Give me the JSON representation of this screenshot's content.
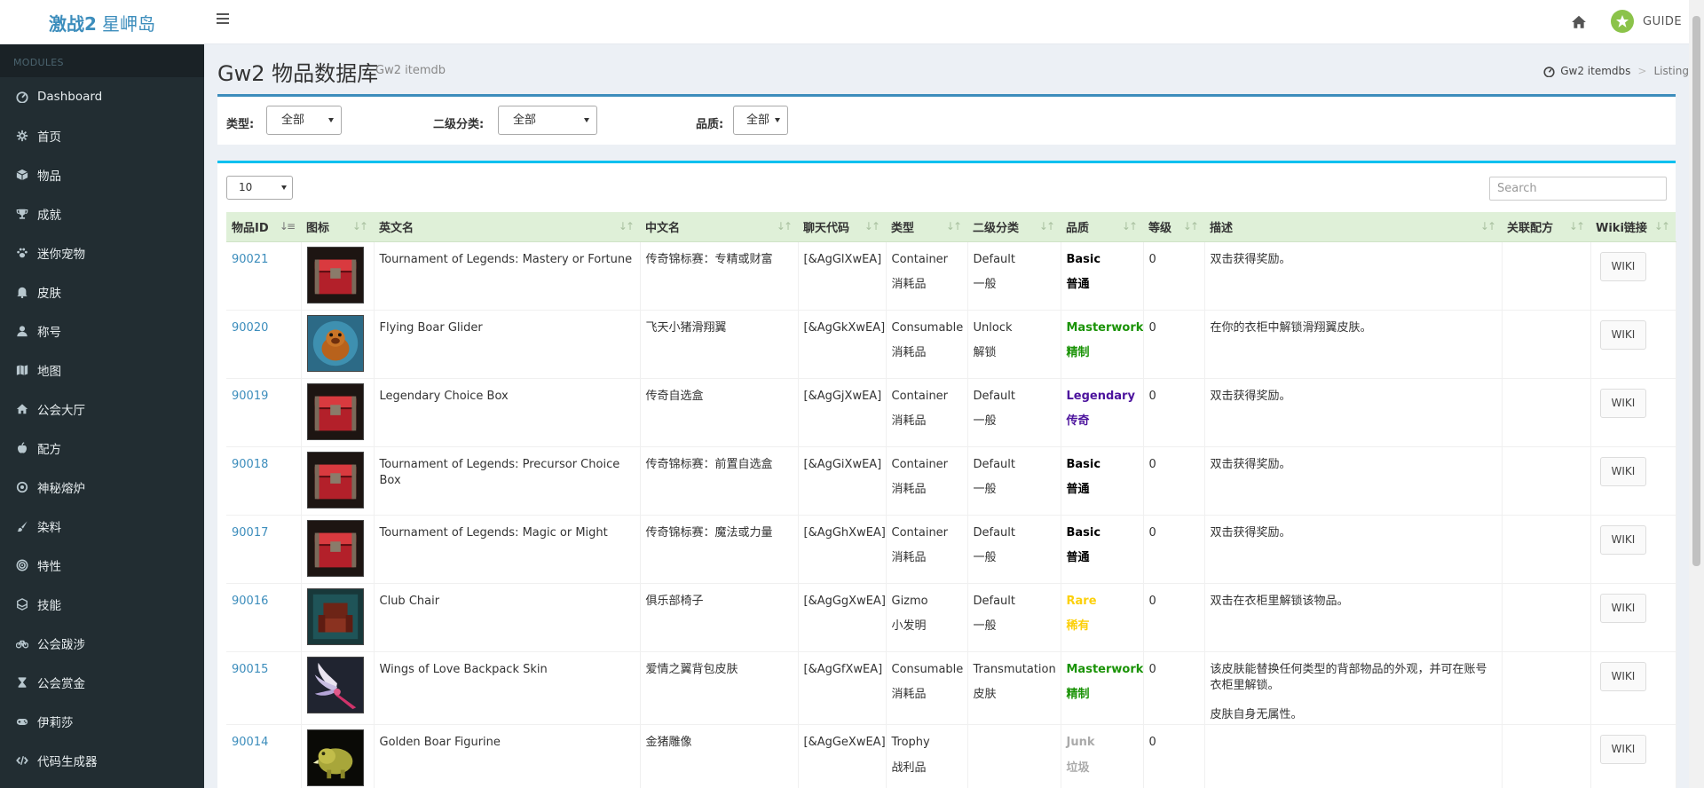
{
  "header": {
    "logo_bold": "激战2",
    "logo_text": "星岬岛",
    "guide": "GUIDE"
  },
  "sidebar": {
    "heading": "MODULES",
    "items": [
      {
        "label": "Dashboard",
        "icon": "tachometer-icon"
      },
      {
        "label": "首页",
        "icon": "cog-icon"
      },
      {
        "label": "物品",
        "icon": "cube-icon"
      },
      {
        "label": "成就",
        "icon": "trophy-icon"
      },
      {
        "label": "迷你宠物",
        "icon": "paw-icon"
      },
      {
        "label": "皮肤",
        "icon": "bell-icon"
      },
      {
        "label": "称号",
        "icon": "user-icon"
      },
      {
        "label": "地图",
        "icon": "map-icon"
      },
      {
        "label": "公会大厅",
        "icon": "home-icon"
      },
      {
        "label": "配方",
        "icon": "apple-icon"
      },
      {
        "label": "神秘熔炉",
        "icon": "dot-circle-icon"
      },
      {
        "label": "染料",
        "icon": "paint-brush-icon"
      },
      {
        "label": "特性",
        "icon": "bullseye-icon"
      },
      {
        "label": "技能",
        "icon": "cubes-icon"
      },
      {
        "label": "公会跋涉",
        "icon": "bicycle-icon"
      },
      {
        "label": "公会赏金",
        "icon": "hourglass-icon"
      },
      {
        "label": "伊莉莎",
        "icon": "gamepad-icon"
      },
      {
        "label": "代码生成器",
        "icon": "code-icon"
      }
    ]
  },
  "page": {
    "title": "Gw2 物品数据库",
    "subtitle": "Gw2 itemdb",
    "breadcrumb": [
      "Gw2 itemdbs",
      "Listing"
    ]
  },
  "filters": {
    "type_label": "类型:",
    "type_value": "全部",
    "subtype_label": "二级分类:",
    "subtype_value": "全部",
    "rarity_label": "品质:",
    "rarity_value": "全部"
  },
  "table": {
    "page_length": "10",
    "search_placeholder": "Search",
    "columns": [
      "物品ID",
      "图标",
      "英文名",
      "中文名",
      "聊天代码",
      "类型",
      "二级分类",
      "品质",
      "等级",
      "描述",
      "关联配方",
      "Wiki链接"
    ],
    "wiki_label": "WIKI",
    "rows": [
      {
        "id": "90021",
        "icon": "chest-icon",
        "en": "Tournament of Legends: Mastery or Fortune",
        "zh": "传奇锦标赛：专精或财富",
        "chat": "[&AgGlXwEA]",
        "type_en": "Container",
        "type_zh": "消耗品",
        "sub_en": "Default",
        "sub_zh": "一般",
        "q_en": "Basic",
        "q_zh": "普通",
        "q_color": "#000000",
        "level": "0",
        "desc": [
          "双击获得奖励。"
        ]
      },
      {
        "id": "90020",
        "icon": "boar-glider-icon",
        "en": "Flying Boar Glider",
        "zh": "飞天小猪滑翔翼",
        "chat": "[&AgGkXwEA]",
        "type_en": "Consumable",
        "type_zh": "消耗品",
        "sub_en": "Unlock",
        "sub_zh": "解锁",
        "q_en": "Masterwork",
        "q_zh": "精制",
        "q_color": "#1a9306",
        "level": "0",
        "desc": [
          "在你的衣柜中解锁滑翔翼皮肤。"
        ]
      },
      {
        "id": "90019",
        "icon": "chest-icon",
        "en": "Legendary Choice Box",
        "zh": "传奇自选盒",
        "chat": "[&AgGjXwEA]",
        "type_en": "Container",
        "type_zh": "消耗品",
        "sub_en": "Default",
        "sub_zh": "一般",
        "q_en": "Legendary",
        "q_zh": "传奇",
        "q_color": "#4c139d",
        "level": "0",
        "desc": [
          "双击获得奖励。"
        ]
      },
      {
        "id": "90018",
        "icon": "chest-icon",
        "en": "Tournament of Legends: Precursor Choice Box",
        "zh": "传奇锦标赛：前置自选盒",
        "chat": "[&AgGiXwEA]",
        "type_en": "Container",
        "type_zh": "消耗品",
        "sub_en": "Default",
        "sub_zh": "一般",
        "q_en": "Basic",
        "q_zh": "普通",
        "q_color": "#000000",
        "level": "0",
        "desc": [
          "双击获得奖励。"
        ]
      },
      {
        "id": "90017",
        "icon": "chest-icon",
        "en": "Tournament of Legends: Magic or Might",
        "zh": "传奇锦标赛：魔法或力量",
        "chat": "[&AgGhXwEA]",
        "type_en": "Container",
        "type_zh": "消耗品",
        "sub_en": "Default",
        "sub_zh": "一般",
        "q_en": "Basic",
        "q_zh": "普通",
        "q_color": "#000000",
        "level": "0",
        "desc": [
          "双击获得奖励。"
        ]
      },
      {
        "id": "90016",
        "icon": "club-chair-icon",
        "en": "Club Chair",
        "zh": "俱乐部椅子",
        "chat": "[&AgGgXwEA]",
        "type_en": "Gizmo",
        "type_zh": "小发明",
        "sub_en": "Default",
        "sub_zh": "一般",
        "q_en": "Rare",
        "q_zh": "稀有",
        "q_color": "#fcd00b",
        "level": "0",
        "desc": [
          "双击在衣柜里解锁该物品。"
        ]
      },
      {
        "id": "90015",
        "icon": "wings-icon",
        "en": "Wings of Love Backpack Skin",
        "zh": "爱情之翼背包皮肤",
        "chat": "[&AgGfXwEA]",
        "type_en": "Consumable",
        "type_zh": "消耗品",
        "sub_en": "Transmutation",
        "sub_zh": "皮肤",
        "q_en": "Masterwork",
        "q_zh": "精制",
        "q_color": "#1a9306",
        "level": "0",
        "desc": [
          "该皮肤能替换任何类型的背部物品的外观，并可在账号衣柜里解锁。",
          "皮肤自身无属性。"
        ]
      },
      {
        "id": "90014",
        "icon": "boar-figurine-icon",
        "en": "Golden Boar Figurine",
        "zh": "金猪雕像",
        "chat": "[&AgGeXwEA]",
        "type_en": "Trophy",
        "type_zh": "战利品",
        "sub_en": "",
        "sub_zh": "",
        "q_en": "Junk",
        "q_zh": "垃圾",
        "q_color": "#aaaaaa",
        "level": "0",
        "desc": []
      }
    ]
  }
}
